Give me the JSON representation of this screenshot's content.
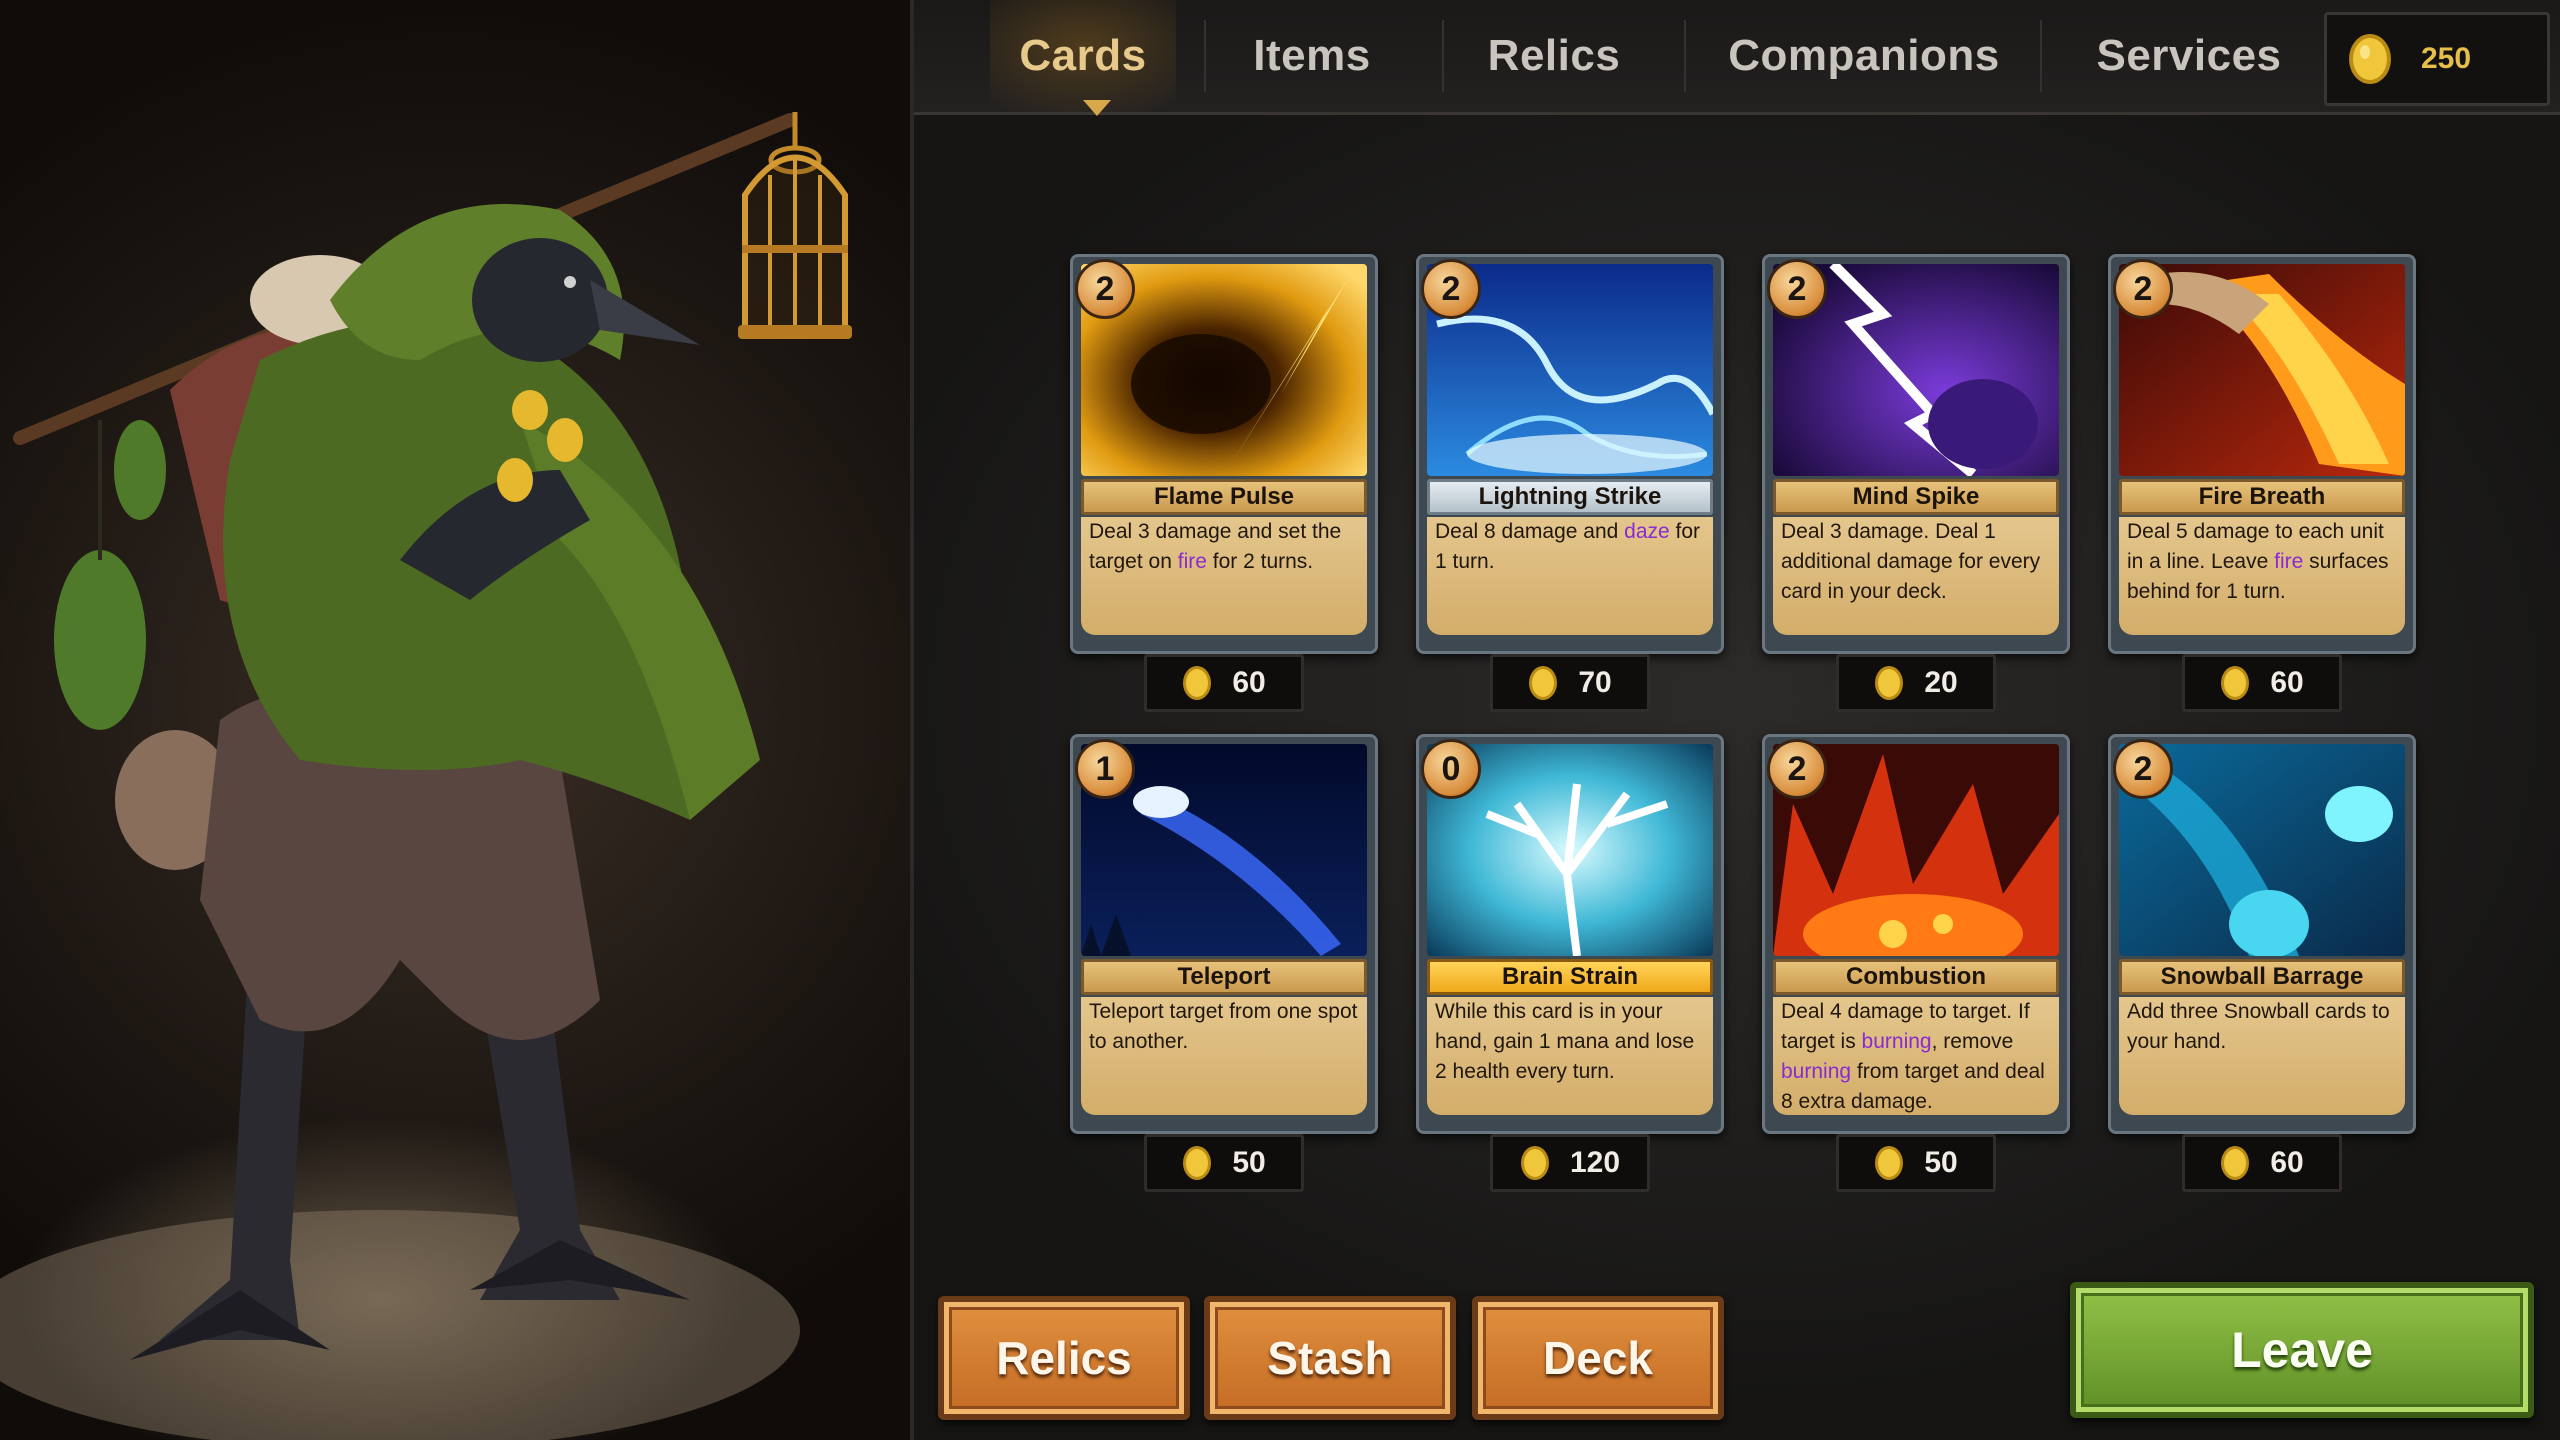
{
  "currency": {
    "gold": "250"
  },
  "tabs": [
    {
      "label": "Cards",
      "active": true
    },
    {
      "label": "Items",
      "active": false
    },
    {
      "label": "Relics",
      "active": false
    },
    {
      "label": "Companions",
      "active": false
    },
    {
      "label": "Services",
      "active": false
    }
  ],
  "cards": [
    {
      "name": "Flame Pulse",
      "cost": "2",
      "price": "60",
      "art": "flame-pulse",
      "desc": [
        "Deal 3 damage and set the target on ",
        {
          "kw": "fire"
        },
        " for 2 turns."
      ]
    },
    {
      "name": "Lightning Strike",
      "cost": "2",
      "price": "70",
      "art": "lightning-strike",
      "banner": "blue",
      "desc": [
        "Deal 8 damage and ",
        {
          "kw": "daze"
        },
        " for 1 turn."
      ]
    },
    {
      "name": "Mind Spike",
      "cost": "2",
      "price": "20",
      "art": "mind-spike",
      "desc": [
        "Deal 3 damage. Deal 1 additional damage for every card in your deck."
      ]
    },
    {
      "name": "Fire Breath",
      "cost": "2",
      "price": "60",
      "art": "fire-breath",
      "desc": [
        "Deal 5 damage to each unit in a line. Leave ",
        {
          "kw": "fire"
        },
        " surfaces behind for 1 turn."
      ]
    },
    {
      "name": "Teleport",
      "cost": "1",
      "price": "50",
      "art": "teleport",
      "desc": [
        "Teleport target from one spot to another."
      ]
    },
    {
      "name": "Brain Strain",
      "cost": "0",
      "price": "120",
      "art": "brain-strain",
      "banner": "gold",
      "desc": [
        "While this card is in your hand, gain 1 mana and lose 2 health every turn."
      ]
    },
    {
      "name": "Combustion",
      "cost": "2",
      "price": "50",
      "art": "combustion",
      "desc": [
        "Deal 4 damage to target. If target is ",
        {
          "kw": "burning"
        },
        ", remove ",
        {
          "kw": "burning"
        },
        " from target and deal 8 extra damage."
      ]
    },
    {
      "name": "Snowball Barrage",
      "cost": "2",
      "price": "60",
      "art": "snowball-barrage",
      "desc": [
        "Add three Snowball cards to your hand."
      ]
    }
  ],
  "buttons": {
    "relics": "Relics",
    "stash": "Stash",
    "deck": "Deck",
    "leave": "Leave"
  },
  "icons": {
    "currency": "gold-coin-icon",
    "merchant": "crow-merchant-illustration"
  },
  "colors": {
    "keyword": "#8a2bd0",
    "gold_text": "#e6bf4a",
    "active_tab": "#e7c98b",
    "leave_green": "#7aa83a",
    "wood_orange": "#d27d32"
  }
}
